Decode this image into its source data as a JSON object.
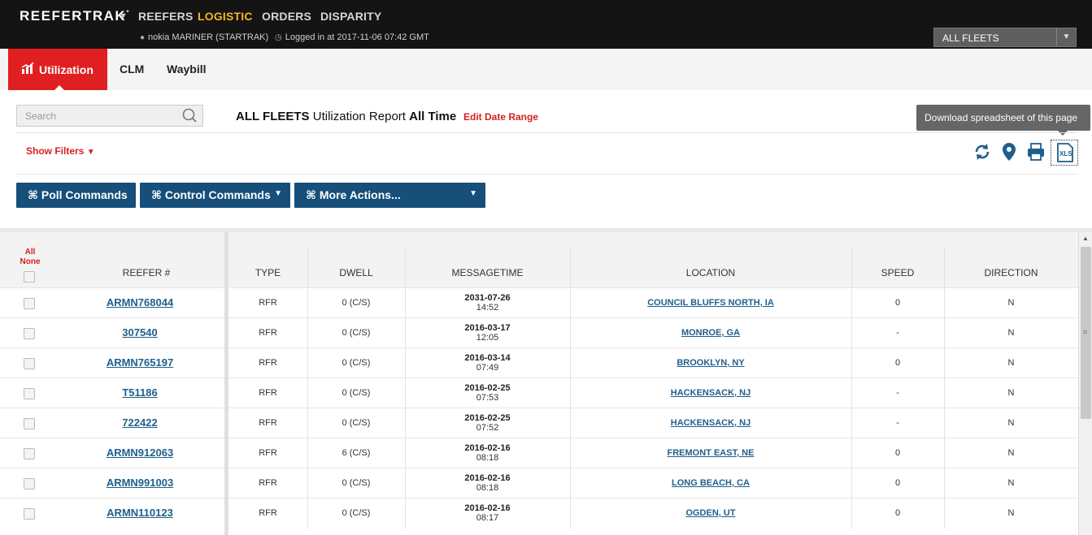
{
  "topbar": {
    "brand": "REEFERTRAK",
    "brand_mark": "°",
    "nav": [
      "REEFERS",
      "LOGISTIC",
      "ORDERS",
      "DISPARITY"
    ],
    "active_nav": "LOGISTIC",
    "user": "nokia MARINER (STARTRAK)",
    "login": "Logged in at 2017-11-06 07:42 GMT",
    "fleet_select": "ALL FLEETS"
  },
  "tabs": [
    "Utilization",
    "CLM",
    "Waybill"
  ],
  "active_tab": "Utilization",
  "search": {
    "placeholder": "Search"
  },
  "report": {
    "fleet": "ALL FLEETS",
    "name": "Utilization Report",
    "range": "All Time",
    "edit_label": "Edit Date Range"
  },
  "tooltip": "Download spreadsheet of this page",
  "filters_label": "Show Filters",
  "toolbar_icons": [
    "refresh-icon",
    "map-pin-icon",
    "print-icon",
    "xls-icon"
  ],
  "xls_label": "XLS",
  "actions": {
    "poll": "⌘ Poll Commands",
    "control": "⌘ Control Commands",
    "more": "⌘ More Actions..."
  },
  "table": {
    "select_all": "All",
    "select_none": "None",
    "columns": {
      "reefer": "REEFER #",
      "type": "TYPE",
      "dwell": "DWELL",
      "messagetime": "MESSAGETIME",
      "location": "LOCATION",
      "speed": "SPEED",
      "direction": "DIRECTION"
    },
    "rows": [
      {
        "reefer": "ARMN768044",
        "type": "RFR",
        "dwell": "0 (C/S)",
        "date": "2031-07-26",
        "time": "14:52",
        "location": "COUNCIL BLUFFS NORTH, IA",
        "speed": "0",
        "direction": "N"
      },
      {
        "reefer": "307540",
        "type": "RFR",
        "dwell": "0 (C/S)",
        "date": "2016-03-17",
        "time": "12:05",
        "location": "MONROE, GA",
        "speed": "-",
        "direction": "N"
      },
      {
        "reefer": "ARMN765197",
        "type": "RFR",
        "dwell": "0 (C/S)",
        "date": "2016-03-14",
        "time": "07:49",
        "location": "BROOKLYN, NY",
        "speed": "0",
        "direction": "N"
      },
      {
        "reefer": "T51186",
        "type": "RFR",
        "dwell": "0 (C/S)",
        "date": "2016-02-25",
        "time": "07:53",
        "location": "HACKENSACK, NJ",
        "speed": "-",
        "direction": "N"
      },
      {
        "reefer": "722422",
        "type": "RFR",
        "dwell": "0 (C/S)",
        "date": "2016-02-25",
        "time": "07:52",
        "location": "HACKENSACK, NJ",
        "speed": "-",
        "direction": "N"
      },
      {
        "reefer": "ARMN912063",
        "type": "RFR",
        "dwell": "6 (C/S)",
        "date": "2016-02-16",
        "time": "08:18",
        "location": "FREMONT EAST, NE",
        "speed": "0",
        "direction": "N"
      },
      {
        "reefer": "ARMN991003",
        "type": "RFR",
        "dwell": "0 (C/S)",
        "date": "2016-02-16",
        "time": "08:18",
        "location": "LONG BEACH, CA",
        "speed": "0",
        "direction": "N"
      },
      {
        "reefer": "ARMN110123",
        "type": "RFR",
        "dwell": "0 (C/S)",
        "date": "2016-02-16",
        "time": "08:17",
        "location": "OGDEN, UT",
        "speed": "0",
        "direction": "N"
      }
    ]
  },
  "colors": {
    "accent_red": "#e02020",
    "link_blue": "#1f5f8c",
    "button_blue": "#154f7a",
    "active_nav": "#f3b61f"
  }
}
